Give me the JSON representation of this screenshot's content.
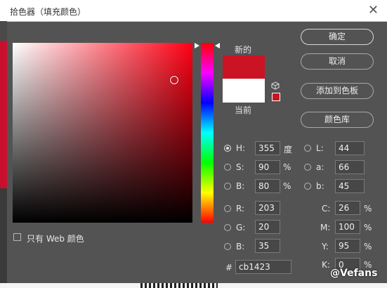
{
  "window": {
    "title": "拾色器（填充颜色）",
    "close": "✕"
  },
  "labels": {
    "new": "新的",
    "current": "当前"
  },
  "colors": {
    "new": "#cb1423",
    "current": "#ffffff"
  },
  "buttons": {
    "ok": "确定",
    "cancel": "取消",
    "add_swatch": "添加到色板",
    "libraries": "颜色库"
  },
  "hsb": {
    "h": {
      "label": "H:",
      "value": "355",
      "unit": "度"
    },
    "s": {
      "label": "S:",
      "value": "90",
      "unit": "%"
    },
    "b": {
      "label": "B:",
      "value": "80",
      "unit": "%"
    }
  },
  "rgb": {
    "r": {
      "label": "R:",
      "value": "203"
    },
    "g": {
      "label": "G:",
      "value": "20"
    },
    "b": {
      "label": "B:",
      "value": "35"
    }
  },
  "lab": {
    "l": {
      "label": "L:",
      "value": "44"
    },
    "a": {
      "label": "a:",
      "value": "66"
    },
    "b": {
      "label": "b:",
      "value": "45"
    }
  },
  "cmyk": {
    "c": {
      "label": "C:",
      "value": "26",
      "unit": "%"
    },
    "m": {
      "label": "M:",
      "value": "100",
      "unit": "%"
    },
    "y": {
      "label": "Y:",
      "value": "95",
      "unit": "%"
    },
    "k": {
      "label": "K:",
      "value": "0",
      "unit": "%"
    }
  },
  "hex": {
    "label": "#",
    "value": "cb1423"
  },
  "web_only": {
    "label": "只有 Web 颜色"
  },
  "watermark": "@Vefans"
}
